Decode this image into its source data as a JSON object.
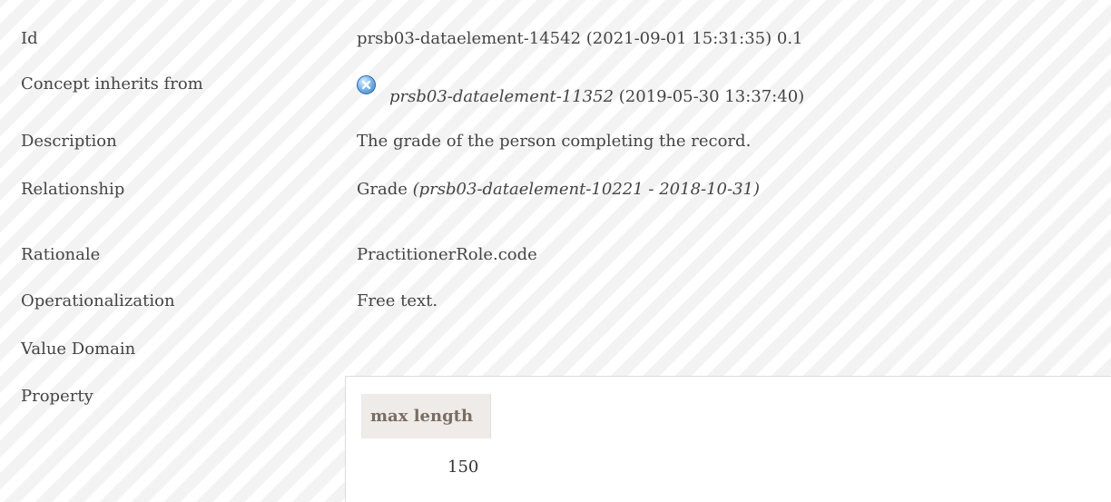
{
  "rows": {
    "id": {
      "label": "Id",
      "value": "prsb03-dataelement-14542 (2021-09-01 15:31:35) 0.1"
    },
    "inherits": {
      "label": "Concept inherits from",
      "ref_id": "prsb03-dataelement-11352",
      "ref_date": "(2019-05-30 13:37:40)",
      "icon": "inherit-icon"
    },
    "description": {
      "label": "Description",
      "value": "The grade of the person completing the record."
    },
    "relationship": {
      "label": "Relationship",
      "name": "Grade",
      "ref": "(prsb03-dataelement-10221 - 2018-10-31)"
    },
    "rationale": {
      "label": "Rationale",
      "value": "PractitionerRole.code"
    },
    "operationalization": {
      "label": "Operationalization",
      "value": "Free text."
    },
    "value_domain": {
      "label": "Value Domain"
    },
    "property": {
      "label": "Property",
      "column_header": "max length",
      "value": "150"
    }
  },
  "colors": {
    "stripe_light": "#ffffff",
    "stripe_dark": "#f3f3f3",
    "text": "#444444",
    "property_header_bg": "#efebe8",
    "property_header_text": "#7a6d63",
    "icon_blue": "#3b7fc4"
  }
}
